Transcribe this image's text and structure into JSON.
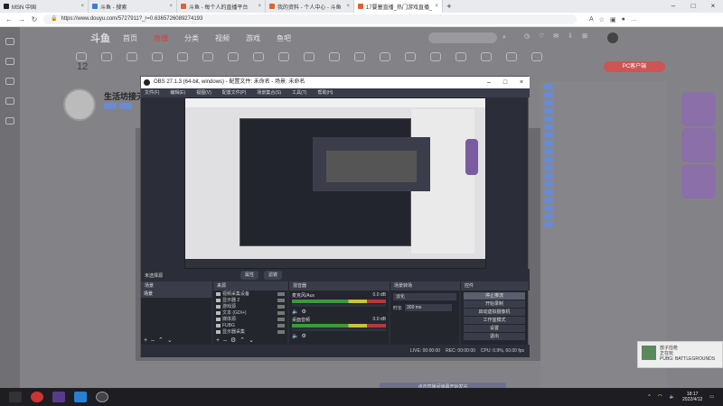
{
  "browser": {
    "tabs": [
      {
        "label": "MSN 中国",
        "color": "#222222"
      },
      {
        "label": "斗鱼 - 搜索",
        "color": "#3b7ddd"
      },
      {
        "label": "斗鱼 - 每个人的直播平台",
        "color": "#e2622c"
      },
      {
        "label": "我的资料 - 个人中心 - 斗鱼",
        "color": "#e2622c"
      },
      {
        "label": "17要塞直播_热门游戏直播_斗鱼",
        "color": "#e2622c"
      }
    ],
    "url": "https://www.douyu.com/5727911?_r=0.6365726089274193"
  },
  "site": {
    "logo": "斗鱼",
    "nav": [
      "首页",
      "直播",
      "分类",
      "视频",
      "游戏",
      "鱼吧"
    ],
    "active_nav": "直播",
    "count": "12",
    "pc_client": "PC客户端",
    "streamer_name": "生活坊接天制"
  },
  "obs": {
    "title": "OBS 27.1.3 (64-bit, windows) - 配置文件: 未命名 - 场景: 未命名",
    "menu": [
      "文件(F)",
      "编辑(E)",
      "视图(V)",
      "配置文件(P)",
      "场景集合(S)",
      "工具(T)",
      "帮助(H)"
    ],
    "no_source": "未选择源",
    "mode_buttons": [
      "属性",
      "滤镜"
    ],
    "dock_titles": [
      "场景",
      "来源",
      "混音器",
      "场景转场",
      "控件"
    ],
    "scenes": [
      "场景"
    ],
    "sources": [
      "视频采集设备",
      "显示器 2",
      "游戏源",
      "文本 (GDI+)",
      "媒体源",
      "FUBG",
      "显示器采集"
    ],
    "mixer": [
      {
        "name": "桌面音频",
        "db": "0.0 dB"
      },
      {
        "name": "麦克风/Aux",
        "db": "0.0 dB"
      }
    ],
    "transition": {
      "type": "淡化",
      "duration_label": "时长",
      "duration": "300 ms"
    },
    "controls": [
      "停止推流",
      "开始录制",
      "启动虚拟摄像机",
      "工作室模式",
      "设置",
      "退出"
    ],
    "status": [
      "LIVE: 00:00:00",
      "REC: 00:00:00",
      "CPU: 0.9%, 60.00 fps"
    ]
  },
  "notification": {
    "app": "放子捡枪",
    "line1": "正在玩",
    "line2": "PUBG: BATTLEGROUNDS"
  },
  "bottom_tip": "点击直播间弹幕开始发言",
  "taskbar": {
    "time": "18:17",
    "date": "2022/4/12"
  }
}
